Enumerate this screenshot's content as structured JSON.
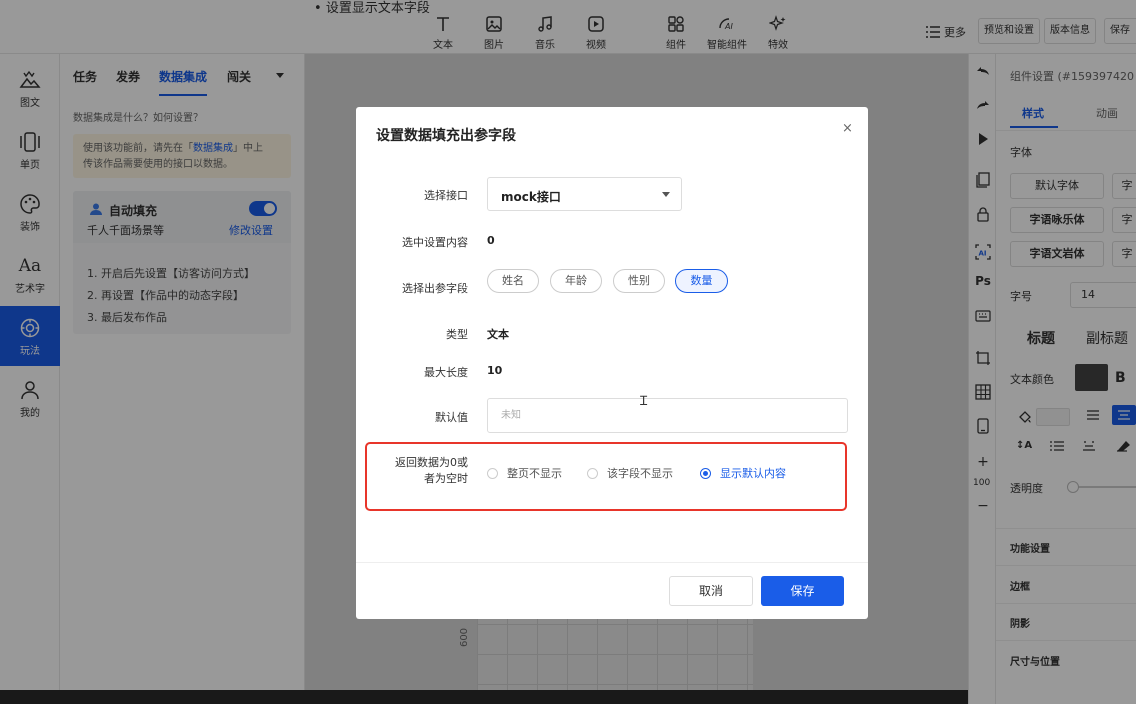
{
  "stray_text": "设置显示文本字段",
  "toolbar": {
    "tools": [
      {
        "label": "文本",
        "icon": "text-icon"
      },
      {
        "label": "图片",
        "icon": "image-icon"
      },
      {
        "label": "音乐",
        "icon": "music-icon"
      },
      {
        "label": "视频",
        "icon": "video-icon"
      },
      {
        "label": "组件",
        "icon": "component-icon"
      },
      {
        "label": "智能组件",
        "icon": "ai-component-icon"
      },
      {
        "label": "特效",
        "icon": "sparkle-icon"
      }
    ],
    "more_label": "更多",
    "preview_settings_label": "预览和设置",
    "version_info_label": "版本信息",
    "save_label": "保存"
  },
  "rail": {
    "items": [
      {
        "label": "图文",
        "icon": "image-text-icon"
      },
      {
        "label": "单页",
        "icon": "single-page-icon"
      },
      {
        "label": "装饰",
        "icon": "palette-icon"
      },
      {
        "label": "艺术字",
        "icon": "art-text-icon"
      },
      {
        "label": "玩法",
        "icon": "gameplay-icon",
        "active": true
      },
      {
        "label": "我的",
        "icon": "user-icon"
      }
    ]
  },
  "left_panel": {
    "tabs": [
      "任务",
      "发券",
      "数据集成",
      "闯关"
    ],
    "active_tab": "数据集成",
    "description": "数据集成是什么？如何设置？",
    "notice": {
      "prefix": "使用该功能前，请先在「",
      "link": "数据集成",
      "suffix": "」中上",
      "line2": "传该作品需要使用的接口以数据。"
    },
    "autofill": {
      "title": "自动填充",
      "subtitle": "千人千面场景等",
      "modify_link": "修改设置",
      "enabled": true,
      "steps": [
        "1. 开启后先设置【访客访问方式】",
        "2. 再设置【作品中的动态字段】",
        "3. 最后发布作品"
      ]
    }
  },
  "right_panel": {
    "title": "组件设置 (#159397420",
    "tabs": [
      "样式",
      "动画"
    ],
    "active_tab": "样式",
    "font_label": "字体",
    "fonts": [
      "默认字体",
      "字语咏乐体",
      "字语文岩体"
    ],
    "font_fragments": [
      "字",
      "字",
      "字"
    ],
    "font_size_label": "字号",
    "font_size_value": "14",
    "heading_labels": [
      "标题",
      "副标题"
    ],
    "text_color_label": "文本颜色",
    "text_color": "#444444",
    "bold_label": "B",
    "opacity_label": "透明度",
    "zoom_text": "100",
    "sections": [
      "功能设置",
      "边框",
      "阴影",
      "尺寸与位置"
    ],
    "ps_label": "Ps"
  },
  "canvas": {
    "ruler_label": "600"
  },
  "dialog": {
    "title": "设置数据填充出参字段",
    "close_label": "×",
    "fields": {
      "api_label": "选择接口",
      "api_value": "mock接口",
      "selected_content_label": "选中设置内容",
      "selected_content_value": "0",
      "out_param_label": "选择出参字段",
      "out_params": [
        "姓名",
        "年龄",
        "性别",
        "数量"
      ],
      "active_out_param": "数量",
      "type_label": "类型",
      "type_value": "文本",
      "max_length_label": "最大长度",
      "max_length_value": "10",
      "default_label": "默认值",
      "default_placeholder": "未知",
      "zero_label_line1": "返回数据为0或",
      "zero_label_line2": "者为空时",
      "zero_options": [
        "整页不显示",
        "该字段不显示",
        "显示默认内容"
      ],
      "zero_selected": "显示默认内容"
    },
    "cancel_label": "取消",
    "save_label": "保存"
  }
}
